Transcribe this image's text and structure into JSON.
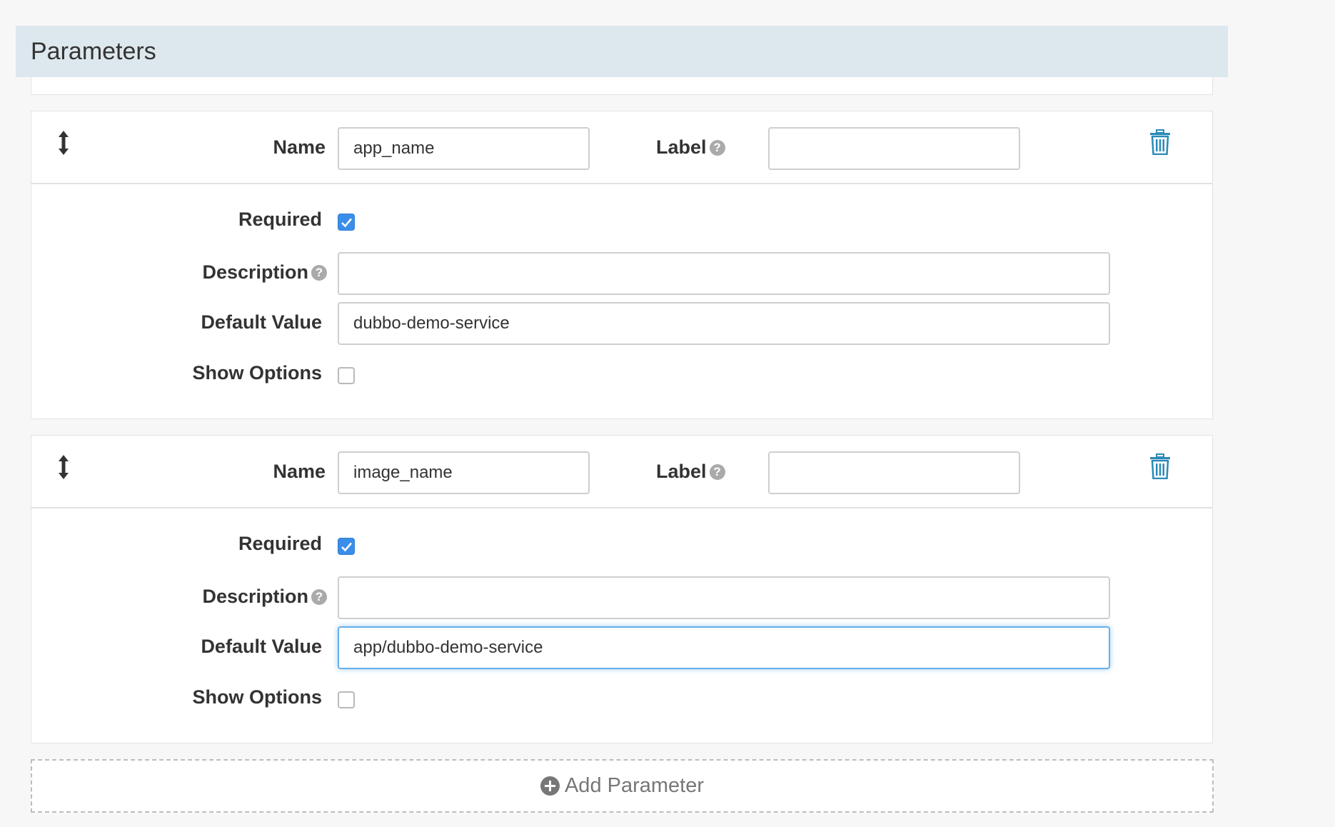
{
  "section": {
    "title": "Parameters"
  },
  "labels": {
    "name": "Name",
    "label": "Label",
    "required": "Required",
    "description": "Description",
    "default_value": "Default Value",
    "show_options": "Show Options",
    "help_glyph": "?"
  },
  "parameters": [
    {
      "name": "app_name",
      "label": "",
      "required": true,
      "description": "",
      "default_value": "dubbo-demo-service",
      "show_options": false
    },
    {
      "name": "image_name",
      "label": "",
      "required": true,
      "description": "",
      "default_value": "app/dubbo-demo-service",
      "show_options": false,
      "default_value_focused": true
    }
  ],
  "add_button": {
    "label": "Add Parameter"
  },
  "icons": {
    "drag": "drag-handle-icon",
    "help": "help-icon",
    "delete": "trash-icon",
    "add": "plus-circle-icon"
  },
  "colors": {
    "header_bg": "#dde7ee",
    "accent": "#3b8ee8",
    "trash": "#2a8ab8",
    "focus": "#66afe9"
  }
}
